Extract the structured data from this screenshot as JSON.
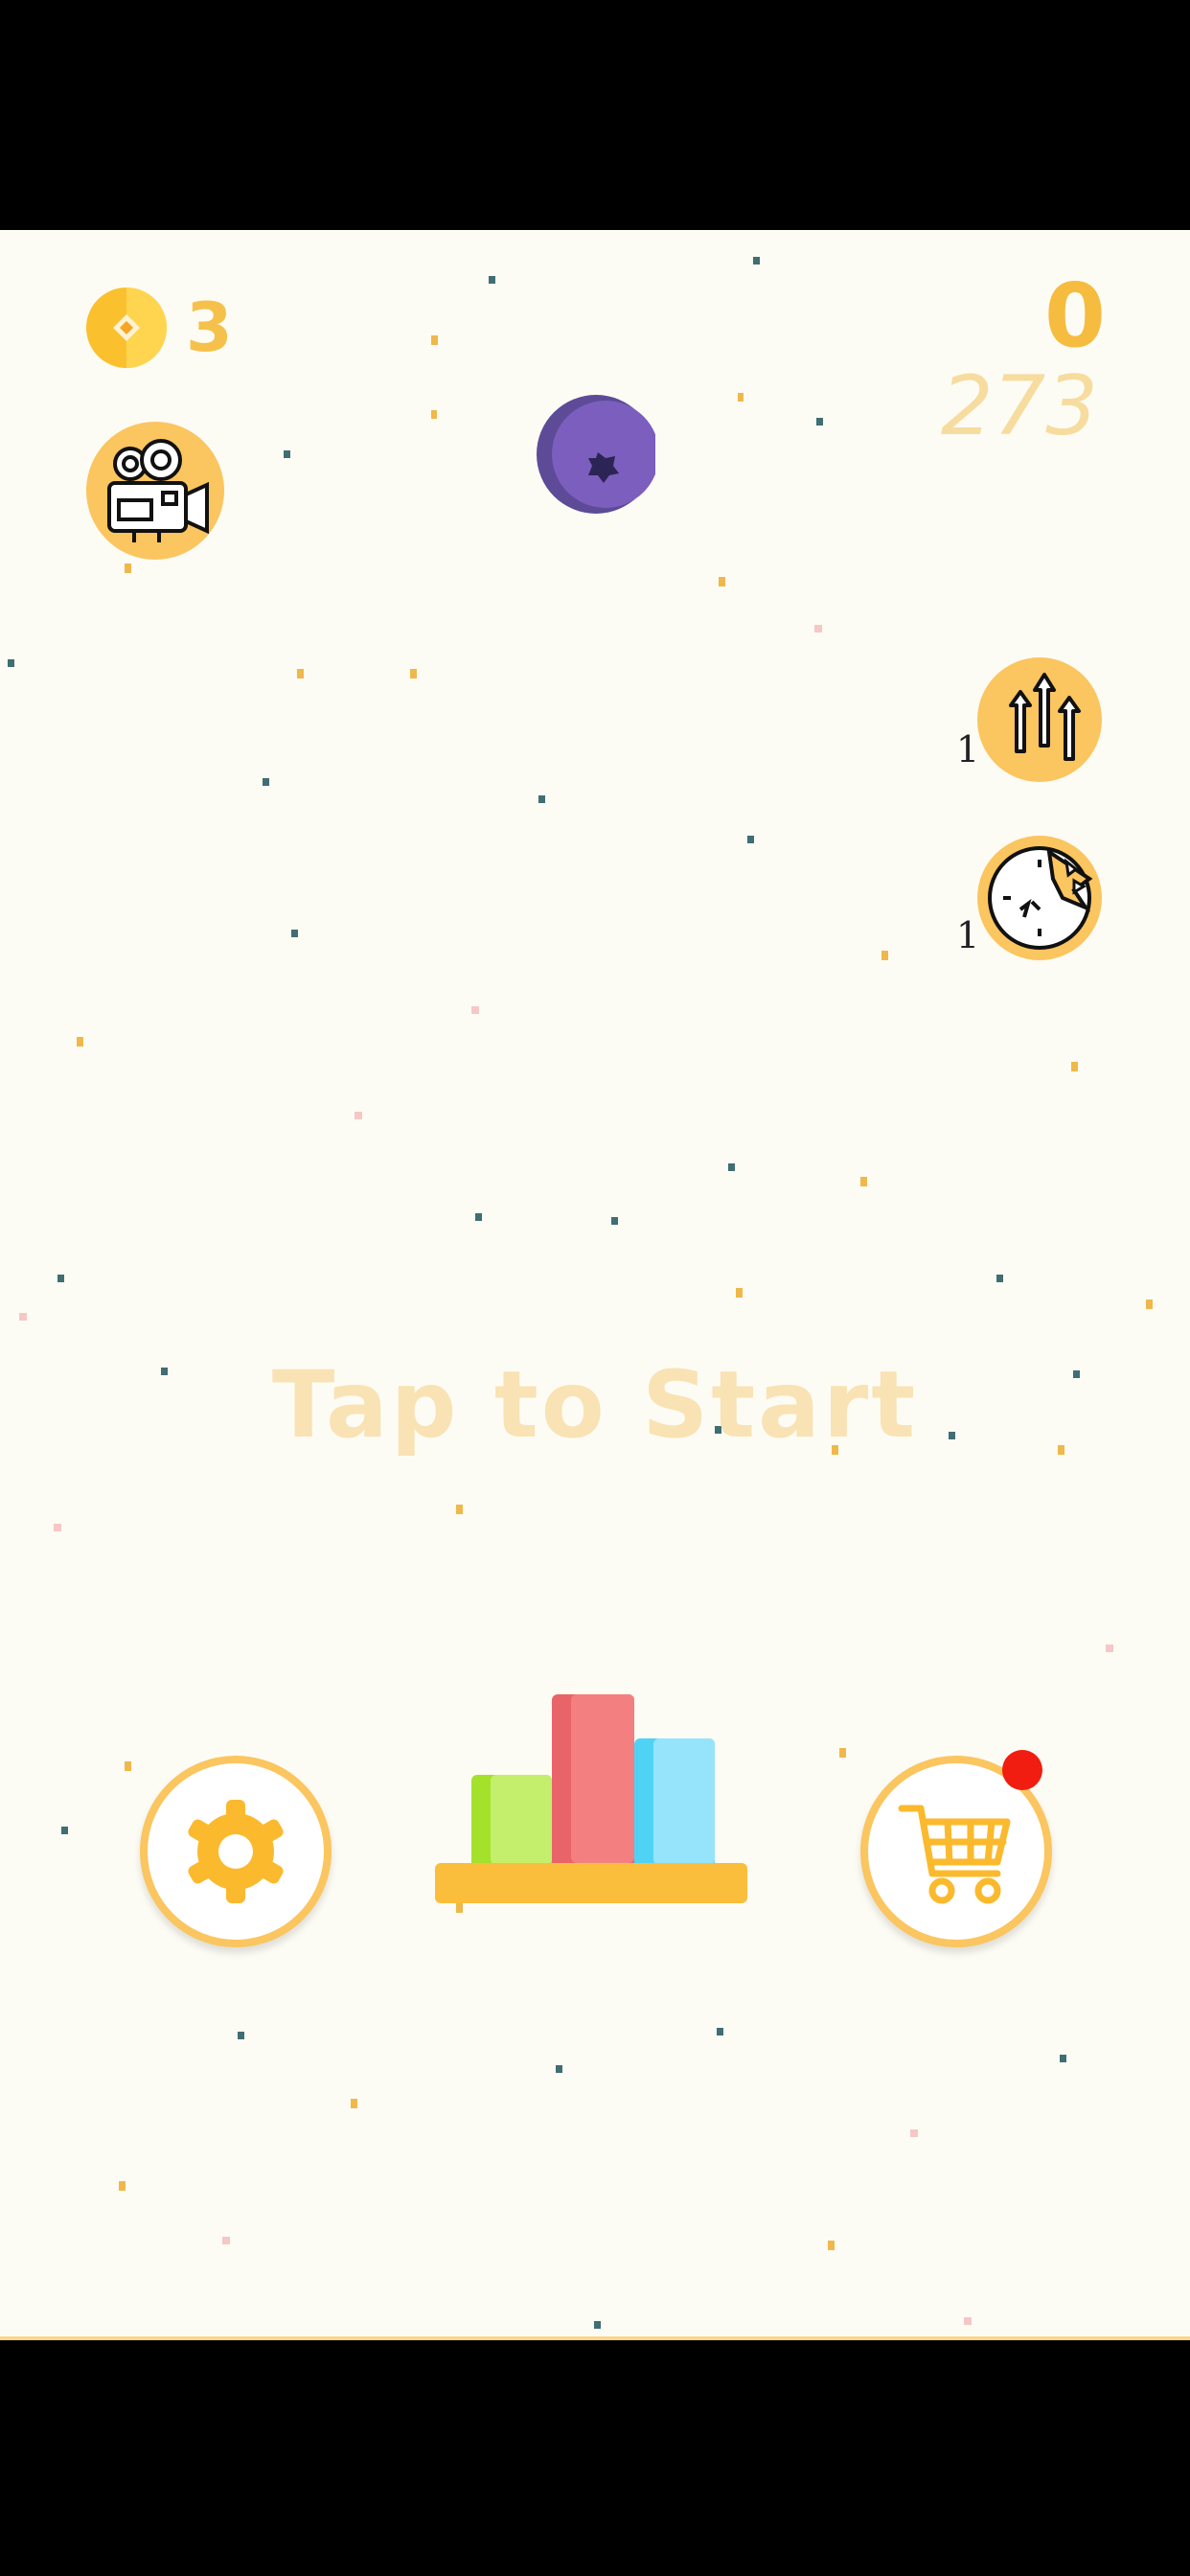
{
  "hud": {
    "coins": "3",
    "score": "0",
    "best_score": "273"
  },
  "powerups": [
    {
      "name": "boost-arrows",
      "count": "1"
    },
    {
      "name": "time-break",
      "count": "1"
    }
  ],
  "prompt": "Tap to Start",
  "icons": {
    "coin": "coin-icon",
    "video": "video-camera-icon",
    "settings": "gear-icon",
    "leaderboard": "leaderboard-icon",
    "shop": "shopping-cart-icon"
  },
  "colors": {
    "background": "#fdfcf4",
    "accent": "#fbc55f",
    "score": "#f5bc3f",
    "best": "#f7dc9f",
    "prompt": "#f9e2b4",
    "ball": "#7b5ebd",
    "notification": "#f01d10"
  }
}
